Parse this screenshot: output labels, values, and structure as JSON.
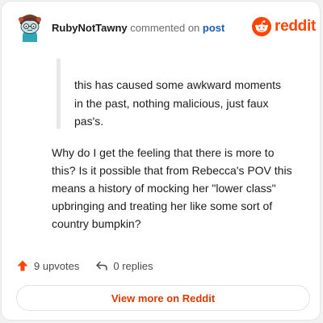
{
  "header": {
    "username": "RubyNotTawny",
    "action_text": "commented on",
    "post_link": "post",
    "avatar": "snoo-avatar-icon"
  },
  "brand": {
    "logo": "reddit-alien-icon",
    "word": "reddit",
    "color": "#ff4500"
  },
  "quote": {
    "lines": [
      "this has caused some awkward moments",
      "in the past, nothing malicious, just faux",
      "pas's."
    ]
  },
  "body": {
    "lines": [
      "Why do I get the feeling that there is more to",
      "this? Is it possible that from Rebecca's POV this",
      "means a history of mocking her \"lower class\"",
      "upbringing and treating her like some sort of",
      "country bumpkin?"
    ]
  },
  "actions": {
    "upvotes_label": "9 upvotes",
    "upvote_icon": "upvote-arrow-icon",
    "upvote_color": "#ff4500",
    "replies_label": "0 replies",
    "reply_icon": "reply-arrow-icon"
  },
  "footer": {
    "view_button_label": "View more on Reddit",
    "view_button_color": "#d93a00"
  }
}
